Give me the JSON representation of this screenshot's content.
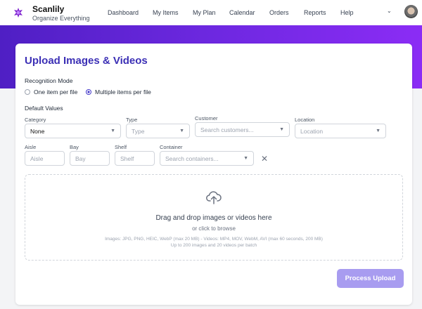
{
  "app": {
    "name": "Scanlily",
    "tagline": "Organize Everything"
  },
  "nav": {
    "items": [
      "Dashboard",
      "My Items",
      "My Plan",
      "Calendar",
      "Orders",
      "Reports",
      "Help"
    ]
  },
  "page": {
    "title": "Upload Images & Videos"
  },
  "recognition": {
    "label": "Recognition Mode",
    "options": [
      "One item per file",
      "Multiple items per file"
    ],
    "selected": "Multiple items per file"
  },
  "defaults": {
    "label": "Default Values",
    "category": {
      "label": "Category",
      "value": "None"
    },
    "type": {
      "label": "Type",
      "placeholder": "Type"
    },
    "customer": {
      "label": "Customer",
      "placeholder": "Search customers..."
    },
    "location": {
      "label": "Location",
      "placeholder": "Location"
    },
    "aisle": {
      "label": "Aisle",
      "placeholder": "Aisle"
    },
    "bay": {
      "label": "Bay",
      "placeholder": "Bay"
    },
    "shelf": {
      "label": "Shelf",
      "placeholder": "Shelf"
    },
    "container": {
      "label": "Container",
      "placeholder": "Search containers..."
    }
  },
  "dropzone": {
    "title": "Drag and drop images or videos here",
    "browse": "or click to browse",
    "formats": "Images: JPG, PNG, HEIC, WebP (max 20 MB) - Videos: MP4, MOV, WebM, AVI (max 60 seconds, 200 MB)",
    "limits": "Up to 200 images and 20 videos per batch"
  },
  "actions": {
    "process": "Process Upload"
  }
}
